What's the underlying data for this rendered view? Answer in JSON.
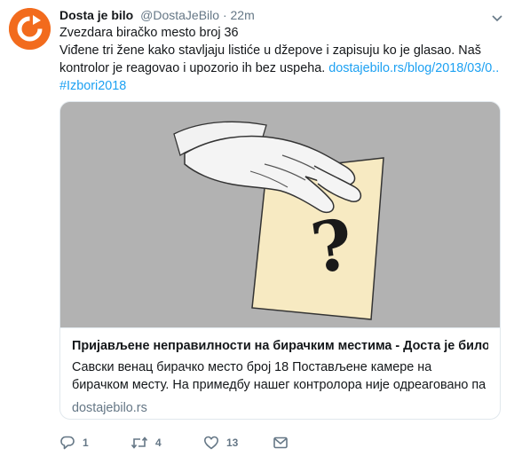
{
  "tweet": {
    "author_name": "Dosta je bilo",
    "handle": "@DostaJeBilo",
    "separator": "·",
    "time": "22m",
    "text_line1": "Zvezdara biračko mesto broj 36",
    "text_line2": "Viđene tri žene kako stavljaju listiće u džepove i zapisuju ko je glasao. Naš",
    "text_line3_start": "kontrolor je reagovao i upozorio ih bez uspeha. ",
    "link": "dostajebilo.rs/blog/2018/03/0...",
    "hashtag": "#Izbori2018"
  },
  "card": {
    "title": "Пријављене неправилности на бирачким местима - Доста је било",
    "description": "Савски венац бирачко место број 18 Постављене камере на бирачком месту. На примедбу нашег контролора није одреаговано па је позван ...",
    "domain": "dostajebilo.rs",
    "image_symbol": "?"
  },
  "actions": {
    "reply_count": "1",
    "retweet_count": "4",
    "like_count": "13"
  },
  "colors": {
    "brand_orange": "#f26b1d",
    "link_blue": "#1da1f2",
    "muted": "#657786"
  }
}
